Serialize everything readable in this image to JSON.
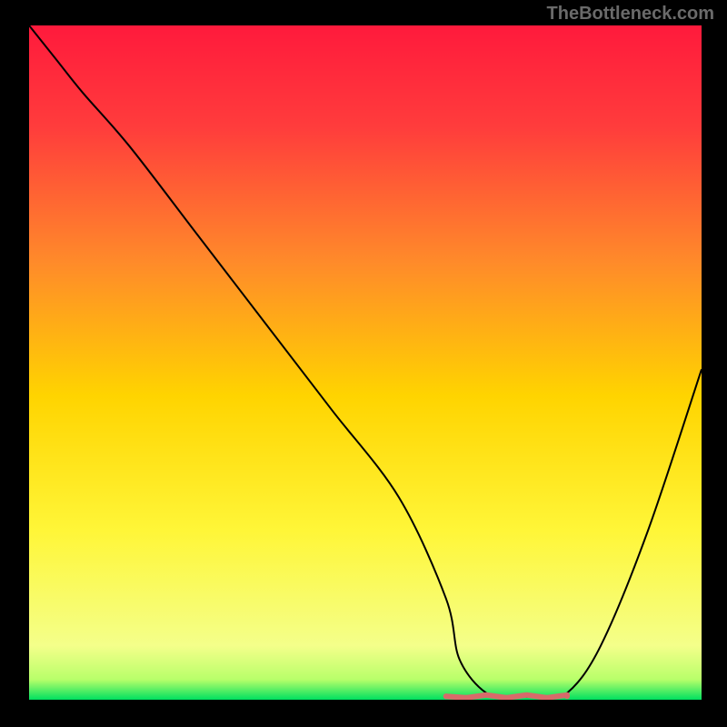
{
  "watermark": "TheBottleneck.com",
  "chart_data": {
    "type": "line",
    "title": "",
    "xlabel": "",
    "ylabel": "",
    "xlim": [
      0,
      100
    ],
    "ylim": [
      0,
      100
    ],
    "grid": false,
    "gradient_stops": [
      {
        "offset": 0.0,
        "color": "#ff1a3c"
      },
      {
        "offset": 0.15,
        "color": "#ff3c3c"
      },
      {
        "offset": 0.35,
        "color": "#ff8a2a"
      },
      {
        "offset": 0.55,
        "color": "#ffd400"
      },
      {
        "offset": 0.75,
        "color": "#fff638"
      },
      {
        "offset": 0.92,
        "color": "#f4ff8a"
      },
      {
        "offset": 0.97,
        "color": "#b8ff6a"
      },
      {
        "offset": 1.0,
        "color": "#00e060"
      }
    ],
    "series": [
      {
        "name": "bottleneck-curve",
        "color": "#000000",
        "x": [
          0,
          4,
          8,
          15,
          25,
          35,
          45,
          55,
          62,
          64,
          68,
          72,
          76,
          80,
          85,
          92,
          100
        ],
        "y": [
          100,
          95,
          90,
          82,
          69,
          56,
          43,
          30,
          15,
          6,
          1,
          0.5,
          0.5,
          1,
          8,
          25,
          49
        ]
      }
    ],
    "marker_band": {
      "name": "optimal-range",
      "color": "#d86a6a",
      "x_start": 62,
      "x_end": 80,
      "y": 0.5,
      "endpoint_radius": 3,
      "stroke_width": 6
    }
  }
}
